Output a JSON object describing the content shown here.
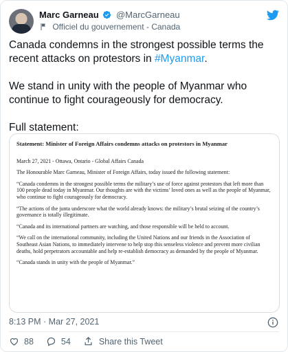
{
  "header": {
    "name": "Marc Garneau",
    "handle": "@MarcGarneau",
    "label": "Officiel du gouvernement - Canada"
  },
  "tweet": {
    "p1_text": "Canada condemns in the strongest possible terms the recent attacks on protestors in ",
    "p1_hashtag": "#Myanmar",
    "p1_end": ".",
    "p2": "We stand in unity with the people of Myanmar who continue to fight courageously for democracy.",
    "p3": "Full statement:"
  },
  "statement": {
    "title": "Statement: Minister of Foreign Affairs condemns attacks on protestors in Myanmar",
    "dateline": "March 27, 2021 - Ottawa, Ontario - Global Affairs Canada",
    "intro": "The Honourable Marc Garneau, Minister of Foreign Affairs, today issued the following statement:",
    "q1": "“Canada condemns in the strongest possible terms the military’s use of force against protestors that left more than 100 people dead today in Myanmar. Our thoughts are with the victims’ loved ones as well as the people of Myanmar, who continue to fight courageously for democracy.",
    "q2": "“The actions of the junta underscore what the world already knows: the military’s brutal seizing of the country’s governance is totally illegitimate.",
    "q3": "“Canada and its international partners are watching, and those responsible will be held to account.",
    "q4": "“We call on the international community, including the United Nations and our friends in the Association of Southeast Asian Nations, to immediately intervene to help stop this senseless violence and prevent more civilian deaths, hold perpetrators accountable and help re-establish democracy as demanded by the people of Myanmar.",
    "q5": "“Canada stands in unity with the people of Myanmar.”"
  },
  "meta": {
    "timestamp": "8:13 PM · Mar 27, 2021"
  },
  "actions": {
    "likes": "88",
    "replies": "54",
    "share": "Share this Tweet"
  },
  "colors": {
    "accent": "#1d9bf0",
    "like_pink": "#f91880",
    "muted": "#536471"
  }
}
